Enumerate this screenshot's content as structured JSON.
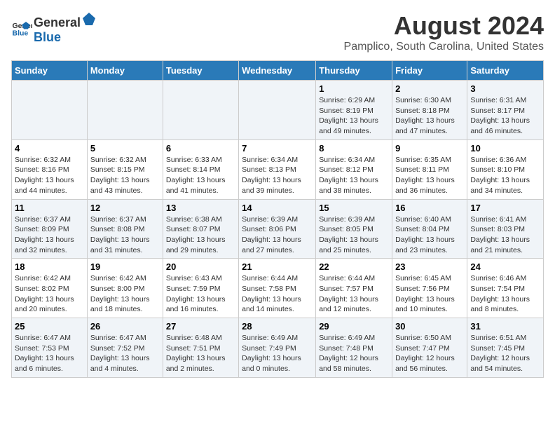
{
  "logo": {
    "general": "General",
    "blue": "Blue"
  },
  "header": {
    "title": "August 2024",
    "subtitle": "Pamplico, South Carolina, United States"
  },
  "days_of_week": [
    "Sunday",
    "Monday",
    "Tuesday",
    "Wednesday",
    "Thursday",
    "Friday",
    "Saturday"
  ],
  "weeks": [
    {
      "days": [
        {
          "number": "",
          "info": ""
        },
        {
          "number": "",
          "info": ""
        },
        {
          "number": "",
          "info": ""
        },
        {
          "number": "",
          "info": ""
        },
        {
          "number": "1",
          "info": "Sunrise: 6:29 AM\nSunset: 8:19 PM\nDaylight: 13 hours\nand 49 minutes."
        },
        {
          "number": "2",
          "info": "Sunrise: 6:30 AM\nSunset: 8:18 PM\nDaylight: 13 hours\nand 47 minutes."
        },
        {
          "number": "3",
          "info": "Sunrise: 6:31 AM\nSunset: 8:17 PM\nDaylight: 13 hours\nand 46 minutes."
        }
      ]
    },
    {
      "days": [
        {
          "number": "4",
          "info": "Sunrise: 6:32 AM\nSunset: 8:16 PM\nDaylight: 13 hours\nand 44 minutes."
        },
        {
          "number": "5",
          "info": "Sunrise: 6:32 AM\nSunset: 8:15 PM\nDaylight: 13 hours\nand 43 minutes."
        },
        {
          "number": "6",
          "info": "Sunrise: 6:33 AM\nSunset: 8:14 PM\nDaylight: 13 hours\nand 41 minutes."
        },
        {
          "number": "7",
          "info": "Sunrise: 6:34 AM\nSunset: 8:13 PM\nDaylight: 13 hours\nand 39 minutes."
        },
        {
          "number": "8",
          "info": "Sunrise: 6:34 AM\nSunset: 8:12 PM\nDaylight: 13 hours\nand 38 minutes."
        },
        {
          "number": "9",
          "info": "Sunrise: 6:35 AM\nSunset: 8:11 PM\nDaylight: 13 hours\nand 36 minutes."
        },
        {
          "number": "10",
          "info": "Sunrise: 6:36 AM\nSunset: 8:10 PM\nDaylight: 13 hours\nand 34 minutes."
        }
      ]
    },
    {
      "days": [
        {
          "number": "11",
          "info": "Sunrise: 6:37 AM\nSunset: 8:09 PM\nDaylight: 13 hours\nand 32 minutes."
        },
        {
          "number": "12",
          "info": "Sunrise: 6:37 AM\nSunset: 8:08 PM\nDaylight: 13 hours\nand 31 minutes."
        },
        {
          "number": "13",
          "info": "Sunrise: 6:38 AM\nSunset: 8:07 PM\nDaylight: 13 hours\nand 29 minutes."
        },
        {
          "number": "14",
          "info": "Sunrise: 6:39 AM\nSunset: 8:06 PM\nDaylight: 13 hours\nand 27 minutes."
        },
        {
          "number": "15",
          "info": "Sunrise: 6:39 AM\nSunset: 8:05 PM\nDaylight: 13 hours\nand 25 minutes."
        },
        {
          "number": "16",
          "info": "Sunrise: 6:40 AM\nSunset: 8:04 PM\nDaylight: 13 hours\nand 23 minutes."
        },
        {
          "number": "17",
          "info": "Sunrise: 6:41 AM\nSunset: 8:03 PM\nDaylight: 13 hours\nand 21 minutes."
        }
      ]
    },
    {
      "days": [
        {
          "number": "18",
          "info": "Sunrise: 6:42 AM\nSunset: 8:02 PM\nDaylight: 13 hours\nand 20 minutes."
        },
        {
          "number": "19",
          "info": "Sunrise: 6:42 AM\nSunset: 8:00 PM\nDaylight: 13 hours\nand 18 minutes."
        },
        {
          "number": "20",
          "info": "Sunrise: 6:43 AM\nSunset: 7:59 PM\nDaylight: 13 hours\nand 16 minutes."
        },
        {
          "number": "21",
          "info": "Sunrise: 6:44 AM\nSunset: 7:58 PM\nDaylight: 13 hours\nand 14 minutes."
        },
        {
          "number": "22",
          "info": "Sunrise: 6:44 AM\nSunset: 7:57 PM\nDaylight: 13 hours\nand 12 minutes."
        },
        {
          "number": "23",
          "info": "Sunrise: 6:45 AM\nSunset: 7:56 PM\nDaylight: 13 hours\nand 10 minutes."
        },
        {
          "number": "24",
          "info": "Sunrise: 6:46 AM\nSunset: 7:54 PM\nDaylight: 13 hours\nand 8 minutes."
        }
      ]
    },
    {
      "days": [
        {
          "number": "25",
          "info": "Sunrise: 6:47 AM\nSunset: 7:53 PM\nDaylight: 13 hours\nand 6 minutes."
        },
        {
          "number": "26",
          "info": "Sunrise: 6:47 AM\nSunset: 7:52 PM\nDaylight: 13 hours\nand 4 minutes."
        },
        {
          "number": "27",
          "info": "Sunrise: 6:48 AM\nSunset: 7:51 PM\nDaylight: 13 hours\nand 2 minutes."
        },
        {
          "number": "28",
          "info": "Sunrise: 6:49 AM\nSunset: 7:49 PM\nDaylight: 13 hours\nand 0 minutes."
        },
        {
          "number": "29",
          "info": "Sunrise: 6:49 AM\nSunset: 7:48 PM\nDaylight: 12 hours\nand 58 minutes."
        },
        {
          "number": "30",
          "info": "Sunrise: 6:50 AM\nSunset: 7:47 PM\nDaylight: 12 hours\nand 56 minutes."
        },
        {
          "number": "31",
          "info": "Sunrise: 6:51 AM\nSunset: 7:45 PM\nDaylight: 12 hours\nand 54 minutes."
        }
      ]
    }
  ]
}
